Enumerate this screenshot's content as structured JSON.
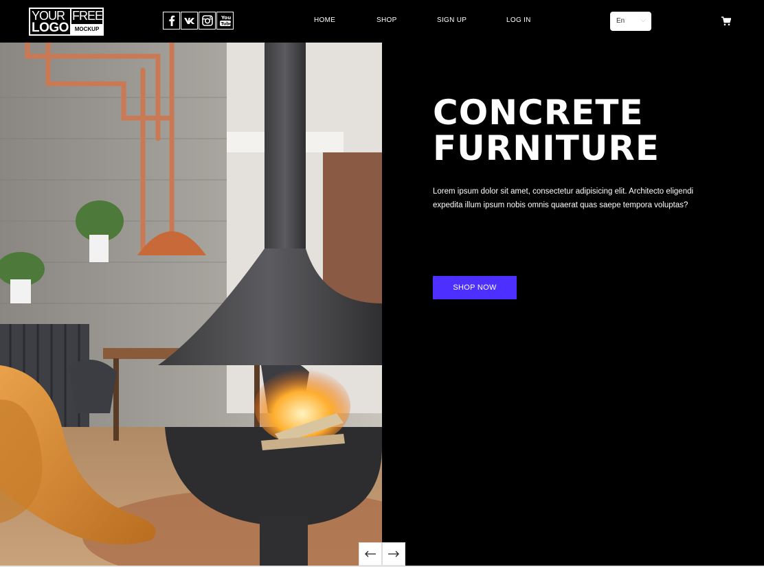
{
  "header": {
    "logo": {
      "line1": "YOUR",
      "line2": "LOGO",
      "free": "FREE",
      "mockup": "MOCKUP"
    },
    "social": [
      {
        "name": "facebook-icon",
        "glyph": "f"
      },
      {
        "name": "vk-icon",
        "glyph": "vk"
      },
      {
        "name": "instagram-icon",
        "glyph": "instagram"
      },
      {
        "name": "youtube-icon",
        "glyph": "You Tube"
      }
    ],
    "nav": {
      "home": "HOME",
      "shop": "SHOP",
      "signup": "SIGN UP",
      "login": "LOG IN"
    },
    "language": {
      "value": "En"
    },
    "cart_icon": "cart-icon"
  },
  "hero": {
    "title_line1": "CONCRETE",
    "title_line2": "FURNITURE",
    "description": "Lorem ipsum dolor sit amet, consectetur adipisicing elit. Architecto eligendi expedita illum ipsum nobis omnis quaerat quas saepe tempora voluptas?",
    "cta": "SHOP NOW",
    "accent_color": "#4d2fff"
  },
  "slider": {
    "prev_icon": "arrow-left-icon",
    "next_icon": "arrow-right-icon"
  }
}
